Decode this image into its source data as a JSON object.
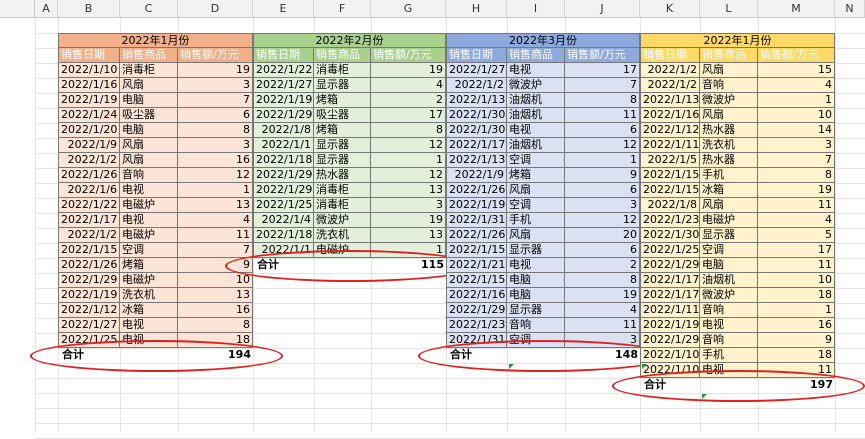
{
  "columns": [
    "A",
    "B",
    "C",
    "D",
    "E",
    "F",
    "G",
    "H",
    "I",
    "J",
    "K",
    "L",
    "M",
    "N"
  ],
  "colors": {
    "t1_header": "#f2b08a",
    "t1_body": "#fce4d6",
    "t2_header": "#a9d18e",
    "t2_body": "#e2efda",
    "t3_header": "#8ea9db",
    "t3_body": "#d9e1f2",
    "t4_header": "#ffd966",
    "t4_body": "#fff2cc",
    "annotation": "#e0201e"
  },
  "headers": [
    "销售日期",
    "销售商品",
    "销售额/万元"
  ],
  "total_label": "合计",
  "tables": [
    {
      "title": "2022年1月份",
      "rows": [
        [
          "2022/1/10",
          "消毒柜",
          "19"
        ],
        [
          "2022/1/16",
          "风扇",
          "3"
        ],
        [
          "2022/1/19",
          "电脑",
          "7"
        ],
        [
          "2022/1/24",
          "吸尘器",
          "6"
        ],
        [
          "2022/1/20",
          "电脑",
          "8"
        ],
        [
          "2022/1/9",
          "风扇",
          "3"
        ],
        [
          "2022/1/2",
          "风扇",
          "16"
        ],
        [
          "2022/1/26",
          "音响",
          "12"
        ],
        [
          "2022/1/6",
          "电视",
          "1"
        ],
        [
          "2022/1/22",
          "电磁炉",
          "13"
        ],
        [
          "2022/1/17",
          "电视",
          "4"
        ],
        [
          "2022/1/2",
          "电磁炉",
          "11"
        ],
        [
          "2022/1/15",
          "空调",
          "7"
        ],
        [
          "2022/1/26",
          "烤箱",
          "9"
        ],
        [
          "2022/1/29",
          "电磁炉",
          "10"
        ],
        [
          "2022/1/19",
          "洗衣机",
          "13"
        ],
        [
          "2022/1/12",
          "冰箱",
          "16"
        ],
        [
          "2022/1/27",
          "电视",
          "8"
        ],
        [
          "2022/1/25",
          "电视",
          "18"
        ]
      ],
      "total": "194"
    },
    {
      "title": "2022年2月份",
      "rows": [
        [
          "2022/1/22",
          "消毒柜",
          "19"
        ],
        [
          "2022/1/27",
          "显示器",
          "4"
        ],
        [
          "2022/1/19",
          "烤箱",
          "2"
        ],
        [
          "2022/1/29",
          "吸尘器",
          "17"
        ],
        [
          "2022/1/8",
          "烤箱",
          "8"
        ],
        [
          "2022/1/1",
          "显示器",
          "12"
        ],
        [
          "2022/1/18",
          "显示器",
          "1"
        ],
        [
          "2022/1/29",
          "热水器",
          "12"
        ],
        [
          "2022/1/29",
          "消毒柜",
          "13"
        ],
        [
          "2022/1/25",
          "消毒柜",
          "3"
        ],
        [
          "2022/1/4",
          "微波炉",
          "19"
        ],
        [
          "2022/1/18",
          "洗衣机",
          "13"
        ],
        [
          "2022/1/1",
          "电磁炉",
          "1"
        ]
      ],
      "total": "115"
    },
    {
      "title": "2022年3月份",
      "rows": [
        [
          "2022/1/27",
          "电视",
          "17"
        ],
        [
          "2022/1/2",
          "微波炉",
          "7"
        ],
        [
          "2022/1/13",
          "油烟机",
          "8"
        ],
        [
          "2022/1/30",
          "油烟机",
          "11"
        ],
        [
          "2022/1/30",
          "电视",
          "6"
        ],
        [
          "2022/1/17",
          "油烟机",
          "12"
        ],
        [
          "2022/1/13",
          "空调",
          "1"
        ],
        [
          "2022/1/9",
          "烤箱",
          "9"
        ],
        [
          "2022/1/26",
          "风扇",
          "6"
        ],
        [
          "2022/1/19",
          "空调",
          "3"
        ],
        [
          "2022/1/31",
          "手机",
          "12"
        ],
        [
          "2022/1/26",
          "风扇",
          "20"
        ],
        [
          "2022/1/15",
          "显示器",
          "6"
        ],
        [
          "2022/1/21",
          "电视",
          "2"
        ],
        [
          "2022/1/15",
          "电脑",
          "8"
        ],
        [
          "2022/1/16",
          "电脑",
          "19"
        ],
        [
          "2022/1/29",
          "显示器",
          "4"
        ],
        [
          "2022/1/23",
          "音响",
          "11"
        ],
        [
          "2022/1/31",
          "空调",
          "3"
        ]
      ],
      "total": "148"
    },
    {
      "title": "2022年1月份",
      "rows": [
        [
          "2022/1/2",
          "风扇",
          "15"
        ],
        [
          "2022/1/2",
          "音响",
          "4"
        ],
        [
          "2022/1/13",
          "微波炉",
          "1"
        ],
        [
          "2022/1/16",
          "风扇",
          "10"
        ],
        [
          "2022/1/12",
          "热水器",
          "14"
        ],
        [
          "2022/1/11",
          "洗衣机",
          "3"
        ],
        [
          "2022/1/5",
          "热水器",
          "7"
        ],
        [
          "2022/1/15",
          "手机",
          "8"
        ],
        [
          "2022/1/15",
          "冰箱",
          "19"
        ],
        [
          "2022/1/8",
          "风扇",
          "11"
        ],
        [
          "2022/1/23",
          "电磁炉",
          "4"
        ],
        [
          "2022/1/30",
          "显示器",
          "5"
        ],
        [
          "2022/1/25",
          "空调",
          "17"
        ],
        [
          "2022/1/29",
          "电脑",
          "11"
        ],
        [
          "2022/1/17",
          "油烟机",
          "10"
        ],
        [
          "2022/1/17",
          "微波炉",
          "18"
        ],
        [
          "2022/1/11",
          "音响",
          "1"
        ],
        [
          "2022/1/19",
          "电视",
          "16"
        ],
        [
          "2022/1/29",
          "音响",
          "9"
        ],
        [
          "2022/1/10",
          "手机",
          "18"
        ],
        [
          "2022/1/10",
          "电视",
          "11"
        ]
      ],
      "total": "197"
    }
  ]
}
